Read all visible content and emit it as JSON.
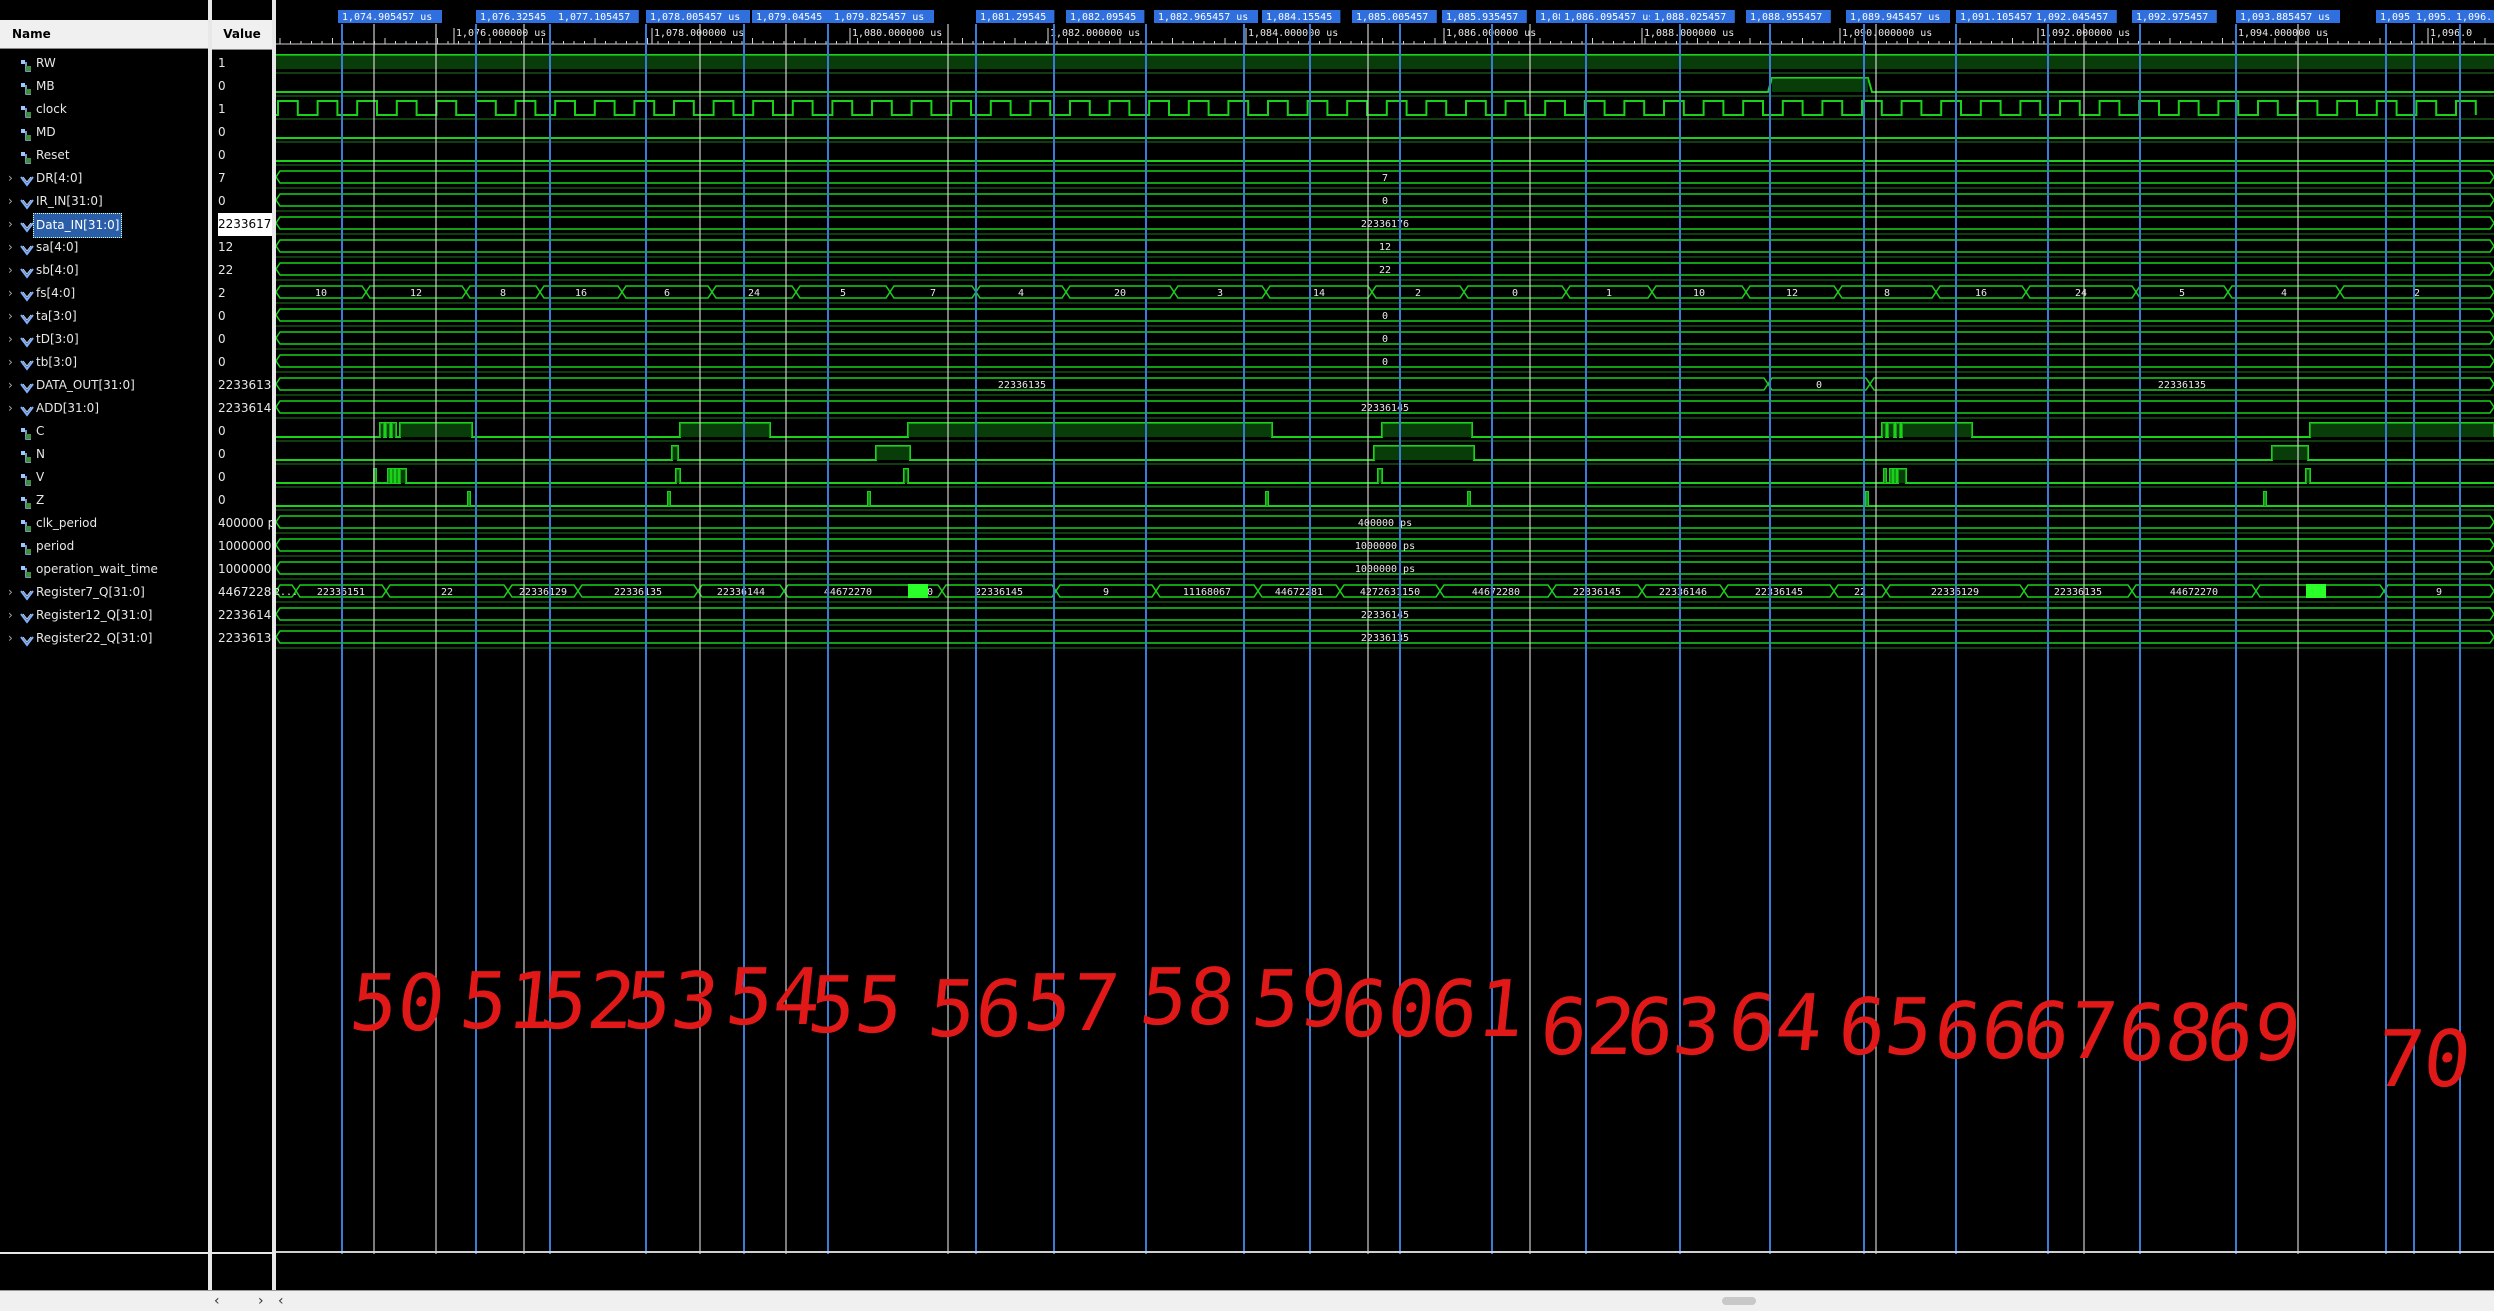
{
  "headers": {
    "name": "Name",
    "value": "Value"
  },
  "signals": [
    {
      "name": "RW",
      "value": "1",
      "kind": "bit",
      "expand": false
    },
    {
      "name": "MB",
      "value": "0",
      "kind": "bit",
      "expand": false
    },
    {
      "name": "clock",
      "value": "1",
      "kind": "bit",
      "expand": false
    },
    {
      "name": "MD",
      "value": "0",
      "kind": "bit",
      "expand": false
    },
    {
      "name": "Reset",
      "value": "0",
      "kind": "bit",
      "expand": false
    },
    {
      "name": "DR[4:0]",
      "value": "7",
      "kind": "bus",
      "expand": true
    },
    {
      "name": "IR_IN[31:0]",
      "value": "0",
      "kind": "bus",
      "expand": true
    },
    {
      "name": "Data_IN[31:0]",
      "value": "2233617",
      "kind": "bus",
      "expand": true,
      "selected": true
    },
    {
      "name": "sa[4:0]",
      "value": "12",
      "kind": "bus",
      "expand": true
    },
    {
      "name": "sb[4:0]",
      "value": "22",
      "kind": "bus",
      "expand": true
    },
    {
      "name": "fs[4:0]",
      "value": "2",
      "kind": "bus",
      "expand": true
    },
    {
      "name": "ta[3:0]",
      "value": "0",
      "kind": "bus",
      "expand": true
    },
    {
      "name": "tD[3:0]",
      "value": "0",
      "kind": "bus",
      "expand": true
    },
    {
      "name": "tb[3:0]",
      "value": "0",
      "kind": "bus",
      "expand": true
    },
    {
      "name": "DATA_OUT[31:0]",
      "value": "2233613",
      "kind": "bus",
      "expand": true
    },
    {
      "name": "ADD[31:0]",
      "value": "2233614",
      "kind": "bus",
      "expand": true
    },
    {
      "name": "C",
      "value": "0",
      "kind": "bit",
      "expand": false
    },
    {
      "name": "N",
      "value": "0",
      "kind": "bit",
      "expand": false
    },
    {
      "name": "V",
      "value": "0",
      "kind": "bit",
      "expand": false
    },
    {
      "name": "Z",
      "value": "0",
      "kind": "bit",
      "expand": false
    },
    {
      "name": "clk_period",
      "value": "400000 p",
      "kind": "bit",
      "expand": false
    },
    {
      "name": "period",
      "value": "1000000",
      "kind": "bit",
      "expand": false
    },
    {
      "name": "operation_wait_time",
      "value": "1000000",
      "kind": "bit",
      "expand": false
    },
    {
      "name": "Register7_Q[31:0]",
      "value": "4467228",
      "kind": "bus",
      "expand": true
    },
    {
      "name": "Register12_Q[31:0]",
      "value": "2233614",
      "kind": "bus",
      "expand": true
    },
    {
      "name": "Register22_Q[31:0]",
      "value": "2233613",
      "kind": "bus",
      "expand": true
    }
  ],
  "ruler_ticks": [
    "1,076.000000 us",
    "1,078.000000 us",
    "1,080.000000 us",
    "1,082.000000 us",
    "1,084.000000 us",
    "1,086.000000 us",
    "1,088.000000 us",
    "1,090.000000 us",
    "1,092.000000 us",
    "1,094.000000 us",
    "1,096.0"
  ],
  "cursor_labels": [
    "1,074.905457 us",
    "1,076.32545",
    "1,077.105457",
    "1,078.005457 us",
    "1,079.04545",
    "1,079.825457 us",
    "1,081.29545",
    "1,082.09545",
    "1,082.965457 us",
    "1,084.15545",
    "1,085.005457",
    "1,085.935457",
    "1,086.09545",
    "1,086.095457 us",
    "1,088.025457",
    "1,088.955457",
    "1,089.945457 us",
    "1,091.105457",
    "1,092.045457",
    "1,092.975457",
    "1,093.885457 us",
    "1,095",
    "1,095.",
    "1,096."
  ],
  "bus_values": {
    "DR": "7",
    "IR_IN": "0",
    "Data_IN": "22336176",
    "sa": "12",
    "sb": "22",
    "fs": [
      "10",
      "12",
      "8",
      "16",
      "6",
      "24",
      "5",
      "7",
      "4",
      "20",
      "3",
      "14",
      "2",
      "0",
      "1",
      "10",
      "12",
      "8",
      "16",
      "24",
      "5",
      "4",
      "2"
    ],
    "ta": "0",
    "tD": "0",
    "tb": "0",
    "DATA_OUT": [
      "22336135",
      "0",
      "22336135"
    ],
    "ADD": "22336145",
    "clk_period": "400000 ps",
    "period": "1000000 ps",
    "operation_wait_time": "1000000 ps",
    "Register7": [
      "2...",
      "22336151",
      "22",
      "22336129",
      "22336135",
      "22336144",
      "44672270",
      "10",
      "22336145",
      "9",
      "11168067",
      "44672281",
      "4272631150",
      "44672280",
      "22336145",
      "22336146",
      "22336145",
      "22",
      "22336129",
      "22336135",
      "44672270",
      "10",
      "9"
    ],
    "Register12": "22336145",
    "Register22": "22336135"
  },
  "annotations": [
    "50",
    "51",
    "52",
    "53",
    "54",
    "55",
    "56",
    "57",
    "58",
    "59",
    "60",
    "61",
    "62",
    "63",
    "64",
    "65",
    "66",
    "67",
    "68",
    "69",
    "70"
  ],
  "colors": {
    "wave": "#19d219",
    "cursor_blue": "#3a7bd5",
    "marker_label_bg": "#2f6fde",
    "annotation": "#e01818"
  }
}
